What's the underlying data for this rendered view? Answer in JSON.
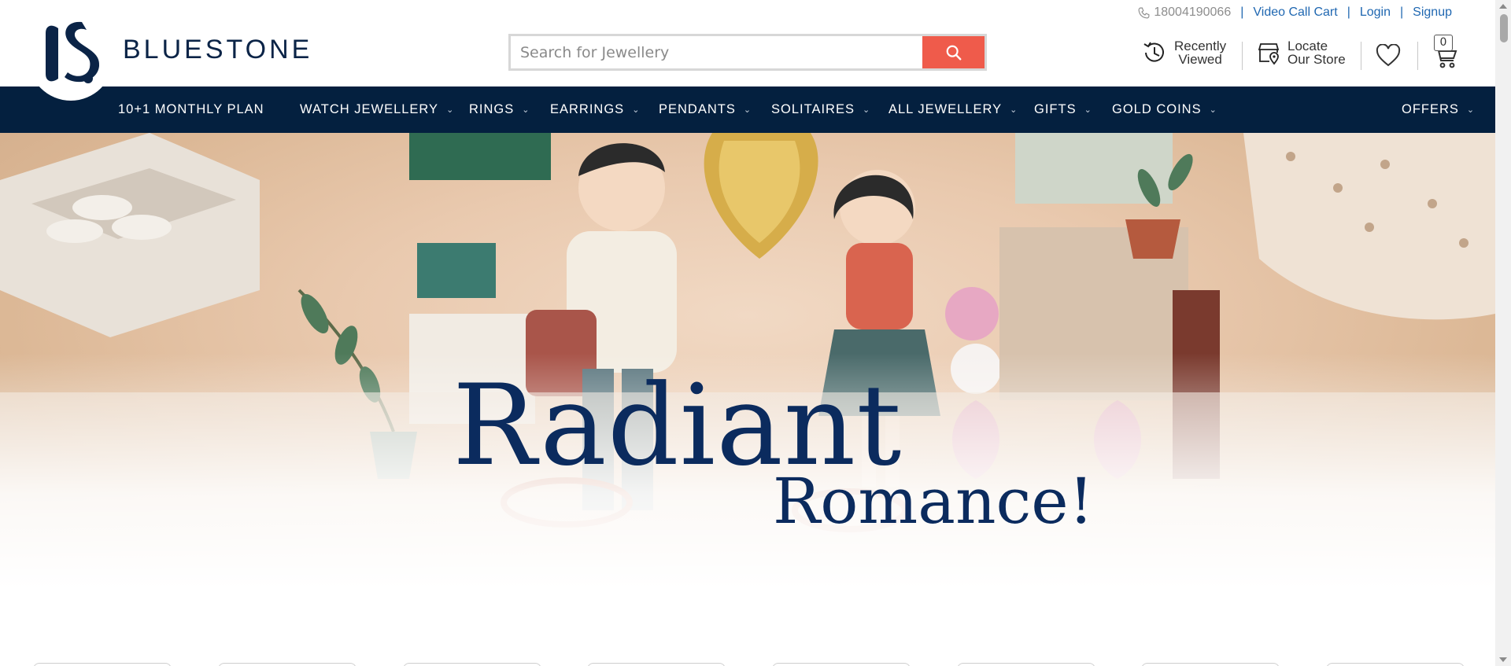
{
  "brand": {
    "name": "BLUESTONE",
    "logo_icon": "bluestone-bs-logo"
  },
  "search": {
    "placeholder": "Search for Jewellery",
    "icon": "search-icon"
  },
  "top_links": {
    "phone": "18004190066",
    "video_call_cart": "Video Call Cart",
    "login": "Login",
    "signup": "Signup"
  },
  "header_actions": {
    "recently_viewed_line1": "Recently",
    "recently_viewed_line2": "Viewed",
    "locate_line1": "Locate",
    "locate_line2": "Our Store",
    "cart_count": "0"
  },
  "nav": {
    "items": [
      {
        "label": "10+1 MONTHLY PLAN",
        "has_dropdown": false
      },
      {
        "label": "WATCH JEWELLERY",
        "has_dropdown": true
      },
      {
        "label": "RINGS",
        "has_dropdown": true
      },
      {
        "label": "EARRINGS",
        "has_dropdown": true
      },
      {
        "label": "PENDANTS",
        "has_dropdown": true
      },
      {
        "label": "SOLITAIRES",
        "has_dropdown": true
      },
      {
        "label": "ALL JEWELLERY",
        "has_dropdown": true
      },
      {
        "label": "GIFTS",
        "has_dropdown": true
      },
      {
        "label": "GOLD COINS",
        "has_dropdown": true
      },
      {
        "label": "OFFERS",
        "has_dropdown": true
      }
    ]
  },
  "hero": {
    "title_line1": "Radiant",
    "title_line2": "Romance!"
  },
  "colors": {
    "nav_bg": "#04203f",
    "brand_navy": "#0b2447",
    "search_button": "#ef5b4b",
    "link_blue": "#1f67b1"
  }
}
